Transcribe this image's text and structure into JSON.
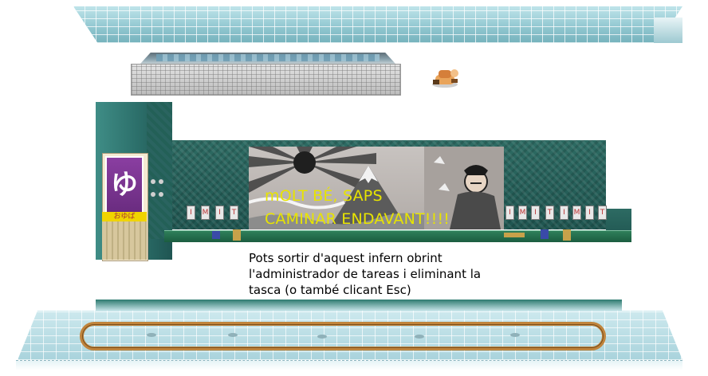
{
  "scene": {
    "noren_glyph": "ゆ",
    "noren_sign": "おゆば",
    "tile_marks": [
      "I",
      "M",
      "I",
      "T"
    ]
  },
  "overlay": {
    "title_line1": "mOLT BÉ, SAPS",
    "title_line2": "CAMINAR ENDAVANT!!!!",
    "help_text": "Pots sortir d'aquest infern obrint l'administrador de tareas i eliminant la tasca (o també clicant Esc)"
  },
  "colors": {
    "title": "#e8e400",
    "help": "#000000",
    "wall": "#2d6b63",
    "track": "#c0843c"
  }
}
